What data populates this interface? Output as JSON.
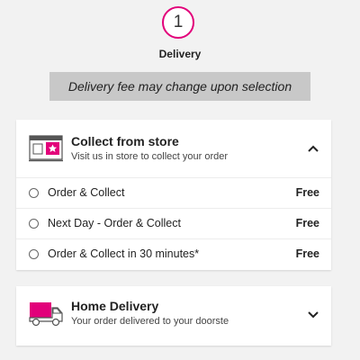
{
  "step": {
    "number": "1",
    "label": "Delivery"
  },
  "notice": "Delivery fee may change upon selection",
  "collect_from_store": {
    "title": "Collect from store",
    "subtitle": "Visit us in store to collect your order",
    "icon": "store-icon",
    "toggle_icon": "chevron-up-icon",
    "options": [
      {
        "label": "Order & Collect",
        "price": "Free"
      },
      {
        "label": "Next Day - Order & Collect",
        "price": "Free"
      },
      {
        "label": "Order & Collect in 30 minutes*",
        "price": "Free"
      }
    ]
  },
  "home_delivery": {
    "title": "Home Delivery",
    "subtitle": "Your order delivered to your doorstep",
    "icon": "delivery-truck-icon",
    "toggle_icon": "chevron-down-icon"
  },
  "colors": {
    "accent": "#e2007a",
    "banner_bg": "#c8c8c8",
    "page_bg": "#f2f2f2"
  }
}
